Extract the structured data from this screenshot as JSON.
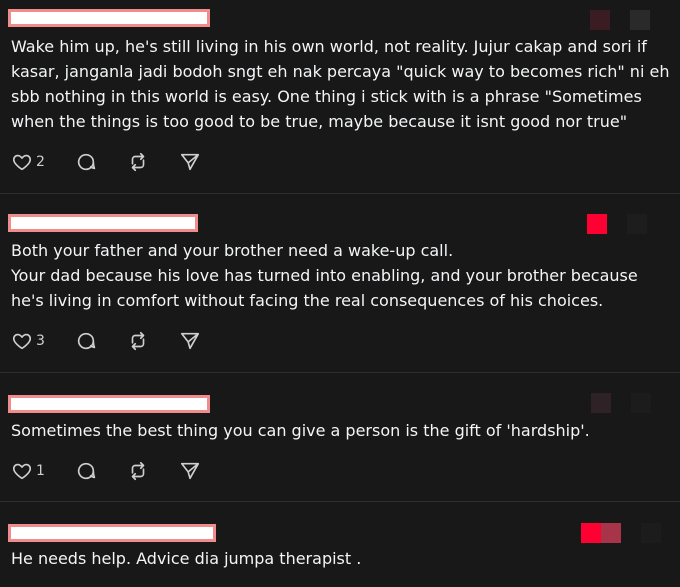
{
  "posts": [
    {
      "text": "Wake him up, he's still living in his own world, not reality. Jujur cakap and sori if\nkasar, janganla jadi bodoh sngt eh nak percaya \"quick way to becomes rich\" ni eh\nsbb nothing in this world is easy. One thing i stick with is a phrase \"Sometimes\nwhen the things is too good to be true, maybe because it isnt good nor true\"",
      "likes": "2"
    },
    {
      "text": "Both your father and your brother need a wake-up call.\nYour dad because his love has turned into enabling, and your brother because\nhe's living in comfort without facing the real consequences of his choices.",
      "likes": "3"
    },
    {
      "text": "Sometimes the best thing you can give a person is the gift of 'hardship'.",
      "likes": "1"
    },
    {
      "text": "He needs help. Advice dia jumpa therapist .",
      "likes": ""
    }
  ],
  "colors": {
    "background": "#181818",
    "text": "#f3f5f7",
    "redaction_fill": "#ffffff",
    "redaction_border": "#f08c8c",
    "accent_red": "#ff0033"
  },
  "icons": {
    "like": "heart-icon",
    "reply": "speech-bubble-icon",
    "repost": "repost-icon",
    "share": "send-icon"
  }
}
